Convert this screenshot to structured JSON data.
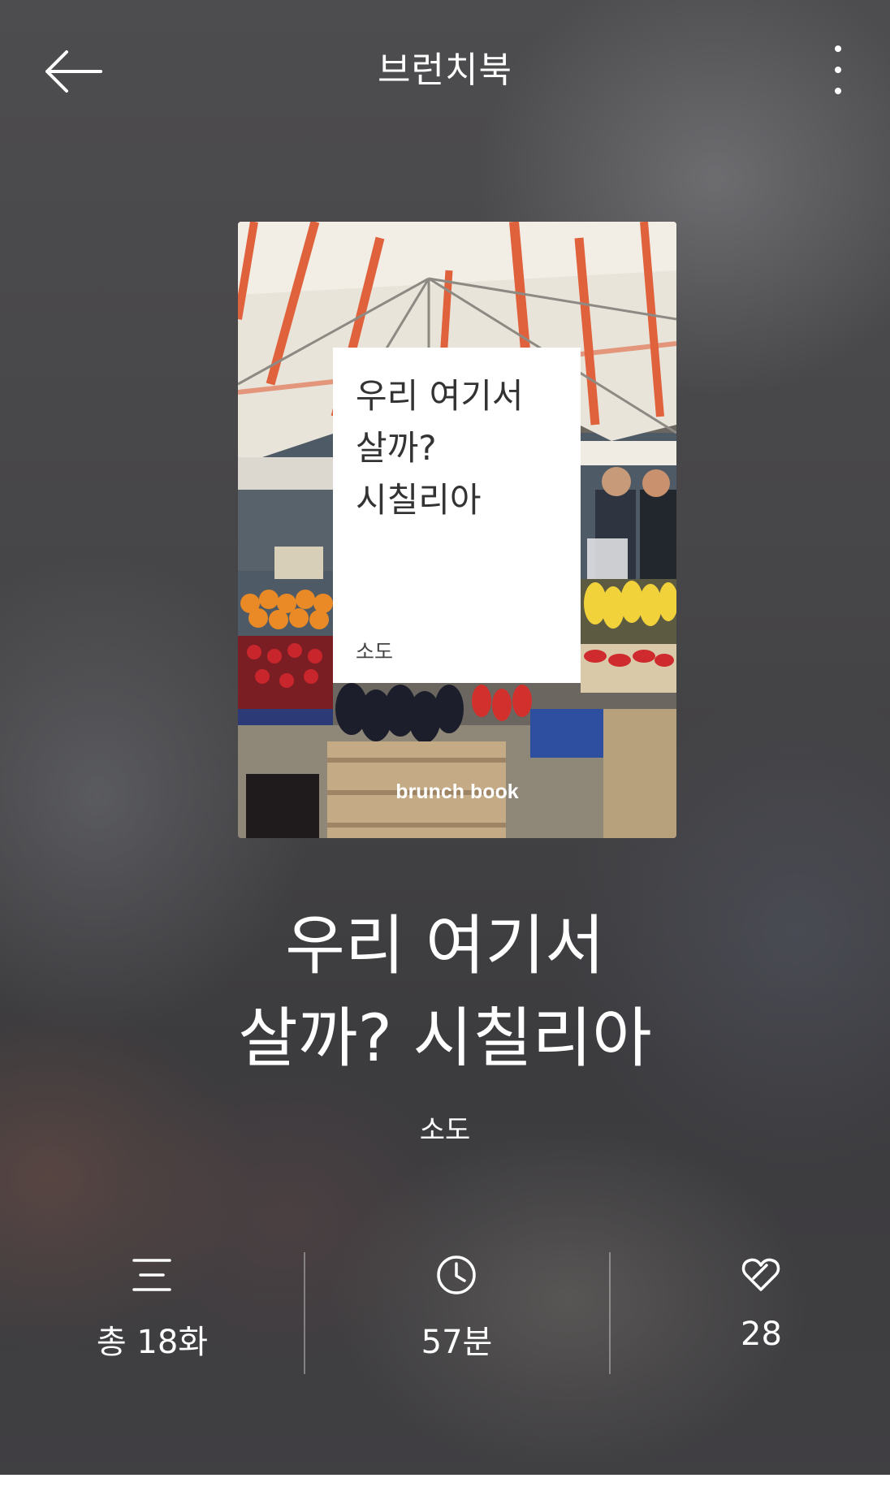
{
  "header": {
    "title": "브런치북"
  },
  "cover": {
    "card_title": "우리 여기서\n살까?\n시칠리아",
    "card_author": "소도",
    "brand": "brunch book"
  },
  "book": {
    "title": "우리 여기서\n살까? 시칠리아",
    "author": "소도"
  },
  "stats": {
    "episodes": "총 18화",
    "reading_time": "57분",
    "likes": "28"
  },
  "icons": {
    "back": "arrow-left-icon",
    "more": "more-vertical-icon",
    "episodes": "list-icon",
    "reading_time": "clock-icon",
    "likes": "heart-icon"
  }
}
